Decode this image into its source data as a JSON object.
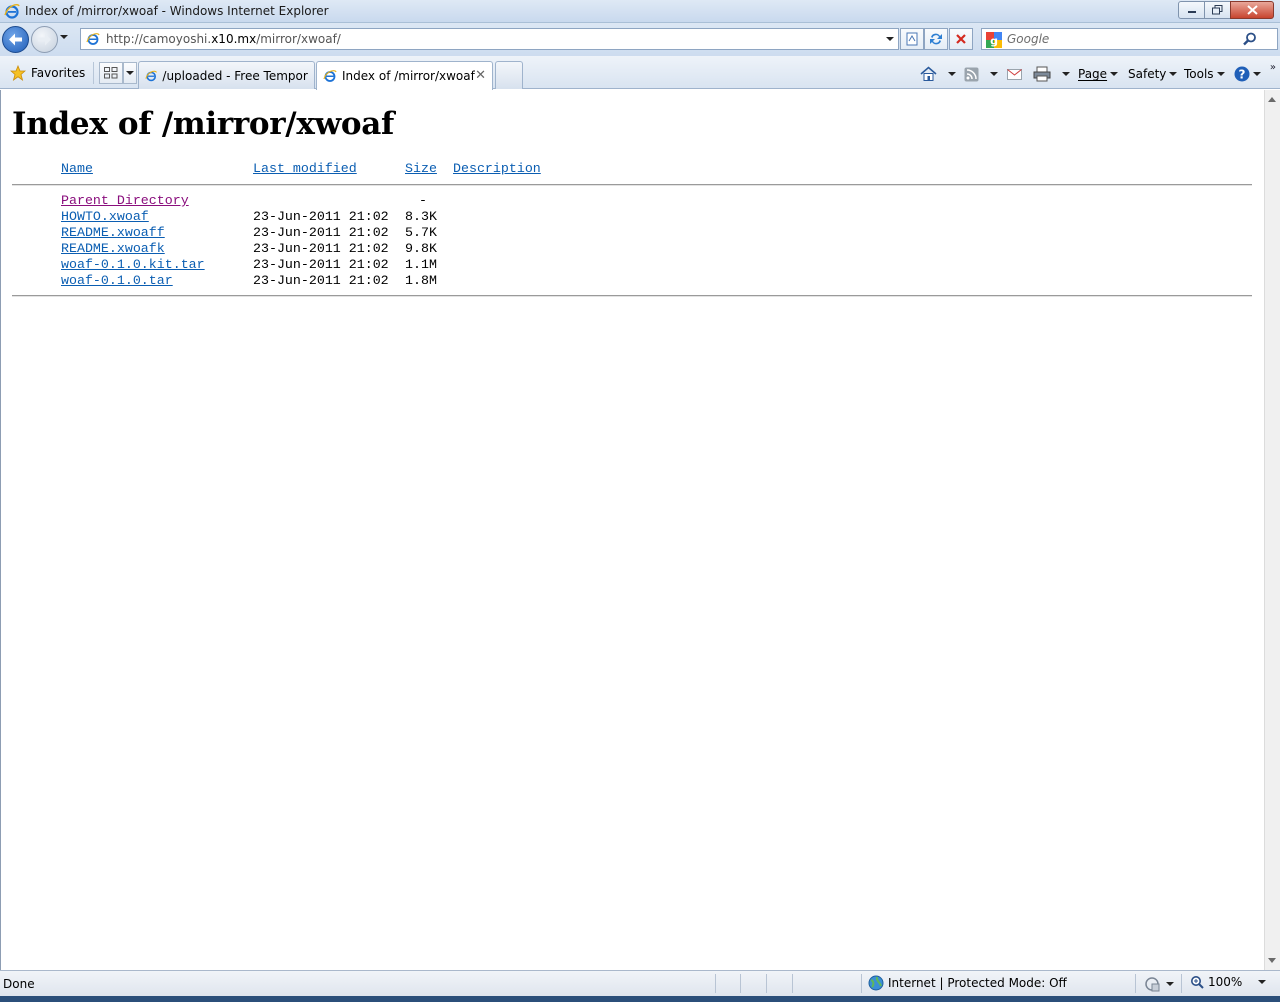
{
  "window": {
    "title": "Index of /mirror/xwoaf - Windows Internet Explorer"
  },
  "address": {
    "url_prefix": "http://camoyoshi.",
    "url_host": "x10.mx",
    "url_path": "/mirror/xwoaf/"
  },
  "search": {
    "placeholder": "Google"
  },
  "favorites": {
    "label": "Favorites"
  },
  "tabs": [
    {
      "label": "/uploaded - Free Tempora...",
      "active": false
    },
    {
      "label": "Index of /mirror/xwoaf",
      "active": true
    }
  ],
  "commands": {
    "page": "Page",
    "safety": "Safety",
    "tools": "Tools"
  },
  "page": {
    "heading": "Index of /mirror/xwoaf",
    "columns": {
      "name": "Name",
      "modified": "Last modified",
      "size": "Size",
      "description": "Description"
    },
    "entries": [
      {
        "name": "Parent Directory",
        "modified": "",
        "size": "-",
        "visited": true
      },
      {
        "name": "HOWTO.xwoaf",
        "modified": "23-Jun-2011 21:02",
        "size": "8.3K"
      },
      {
        "name": "README.xwoaff",
        "modified": "23-Jun-2011 21:02",
        "size": "5.7K"
      },
      {
        "name": "README.xwoafk",
        "modified": "23-Jun-2011 21:02",
        "size": "9.8K"
      },
      {
        "name": "woaf-0.1.0.kit.tar",
        "modified": "23-Jun-2011 21:02",
        "size": "1.1M"
      },
      {
        "name": "woaf-0.1.0.tar",
        "modified": "23-Jun-2011 21:02",
        "size": "1.8M"
      }
    ]
  },
  "status": {
    "text": "Done",
    "zone": "Internet | Protected Mode: Off",
    "zoom": "100%"
  },
  "colors": {
    "link": "#0b5eb2",
    "visited": "#8a0e7d"
  }
}
